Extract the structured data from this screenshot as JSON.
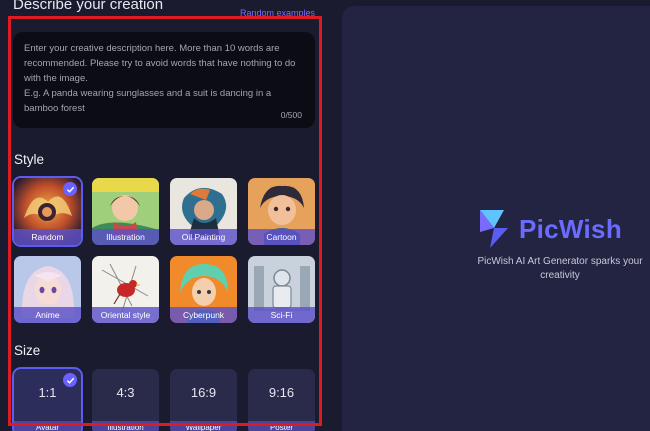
{
  "describe": {
    "title": "Describe your creation",
    "random_link": "Random examples",
    "placeholder": "Enter your creative description here. More than 10 words are recommended. Please try to avoid words that have nothing to do with the image.",
    "example": "E.g. A panda wearing sunglasses and a suit is dancing in a bamboo forest",
    "count": "0/500"
  },
  "style": {
    "title": "Style",
    "items": [
      {
        "label": "Random",
        "selected": true
      },
      {
        "label": "Illustration",
        "selected": false
      },
      {
        "label": "Oil Painting",
        "selected": false
      },
      {
        "label": "Cartoon",
        "selected": false
      },
      {
        "label": "Anime",
        "selected": false
      },
      {
        "label": "Oriental style",
        "selected": false
      },
      {
        "label": "Cyberpunk",
        "selected": false
      },
      {
        "label": "Sci-Fi",
        "selected": false
      }
    ]
  },
  "size": {
    "title": "Size",
    "items": [
      {
        "ratio": "1:1",
        "sub": "Avatar",
        "selected": true
      },
      {
        "ratio": "4:3",
        "sub": "Illustration",
        "selected": false
      },
      {
        "ratio": "16:9",
        "sub": "Wallpaper",
        "selected": false
      },
      {
        "ratio": "9:16",
        "sub": "Poster",
        "selected": false
      }
    ]
  },
  "brand": {
    "name": "PicWish",
    "tagline": "PicWish AI Art Generator sparks your creativity"
  },
  "colors": {
    "accent": "#6b6cff",
    "highlight": "#e01a22",
    "panel": "#232441",
    "background": "#1a1b2e"
  }
}
